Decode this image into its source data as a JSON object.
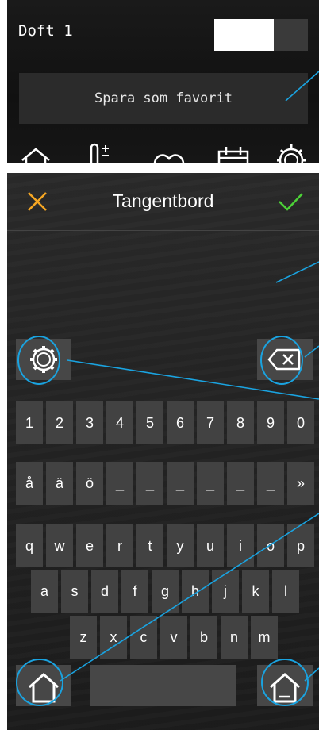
{
  "top_panel": {
    "scene_title": "Doft 1",
    "favorite_button": "Spara som favorit",
    "nav_icons": [
      "home-icon",
      "temperature-icon",
      "heart-icon",
      "calendar-icon",
      "gear-icon"
    ]
  },
  "keyboard": {
    "title": "Tangentbord",
    "cancel_icon": "close-icon",
    "confirm_icon": "checkmark-icon",
    "text_value": "",
    "rows": [
      [
        "1",
        "2",
        "3",
        "4",
        "5",
        "6",
        "7",
        "8",
        "9",
        "0"
      ],
      [
        "å",
        "ä",
        "ö",
        "_",
        "_",
        "_",
        "_",
        "_",
        "_",
        "»"
      ],
      [
        "q",
        "w",
        "e",
        "r",
        "t",
        "y",
        "u",
        "i",
        "o",
        "p"
      ],
      [
        "a",
        "s",
        "d",
        "f",
        "g",
        "h",
        "j",
        "k",
        "l"
      ],
      [
        "z",
        "x",
        "c",
        "v",
        "b",
        "n",
        "m"
      ]
    ]
  },
  "colors": {
    "accent_orange": "#f5a623",
    "accent_green": "#4cd137",
    "callout_blue": "#1aa3e0"
  }
}
